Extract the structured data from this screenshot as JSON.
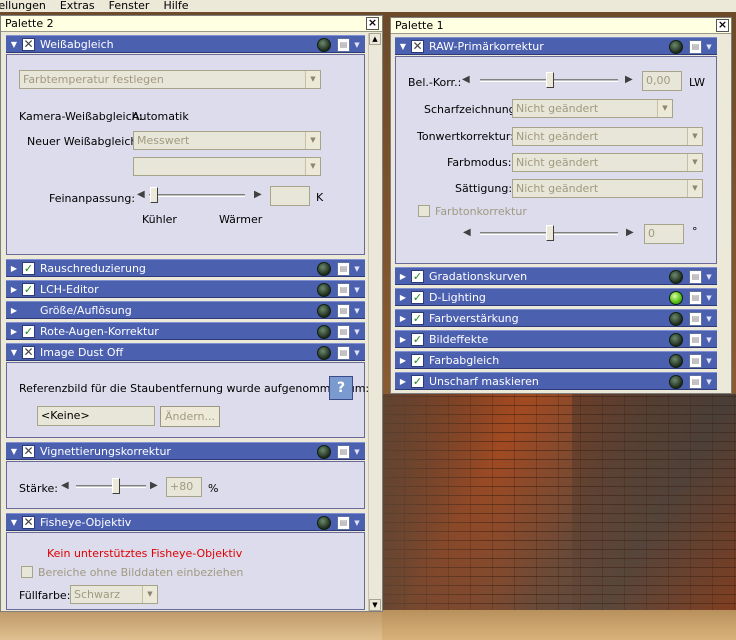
{
  "menu": [
    "tellungen",
    "Extras",
    "Fenster",
    "Hilfe"
  ],
  "palette2": {
    "title": "Palette 2",
    "close": "×",
    "wb": {
      "title": "Weißabgleich",
      "dropdown": "Farbtemperatur festlegen",
      "camera_label": "Kamera-Weißabgleich:",
      "camera_value": "Automatik",
      "new_label": "Neuer Weißabgleich:",
      "new_value": "Messwert",
      "second_value": "",
      "fine_label": "Feinanpassung:",
      "fine_value": "",
      "fine_unit": "K",
      "cooler": "Kühler",
      "warmer": "Wärmer"
    },
    "sections": [
      {
        "label": "Rauschreduzierung"
      },
      {
        "label": "LCH-Editor"
      },
      {
        "label": "Größe/Auflösung"
      },
      {
        "label": "Rote-Augen-Korrektur"
      }
    ],
    "dust": {
      "title": "Image Dust Off",
      "message": "Referenzbild für die Staubentfernung wurde aufgenommen um:",
      "field": "<Keine>",
      "button": "Ändern..."
    },
    "vignette": {
      "title": "Vignettierungskorrektur",
      "label": "Stärke:",
      "value": "+80",
      "unit": "%"
    },
    "fisheye": {
      "title": "Fisheye-Objektiv",
      "warning": "Kein unterstütztes Fisheye-Objektiv",
      "checkbox": "Bereiche ohne Bilddaten einbeziehen",
      "fill_label": "Füllfarbe:",
      "fill_value": "Schwarz"
    }
  },
  "palette1": {
    "title": "Palette 1",
    "close": "×",
    "raw": {
      "title": "RAW-Primärkorrektur",
      "exposure_label": "Bel.-Korr.:",
      "exposure_value": "0,00",
      "exposure_unit": "LW",
      "rows": [
        {
          "label": "Scharfzeichnung:",
          "value": "Nicht geändert"
        },
        {
          "label": "Tonwertkorrektur:",
          "value": "Nicht geändert"
        },
        {
          "label": "Farbmodus:",
          "value": "Nicht geändert"
        },
        {
          "label": "Sättigung:",
          "value": "Nicht geändert"
        }
      ],
      "hue_checkbox": "Farbtonkorrektur",
      "hue_value": "0",
      "hue_unit": "°"
    },
    "sections": [
      {
        "label": "Gradationskurven",
        "active": false
      },
      {
        "label": "D-Lighting",
        "active": true
      },
      {
        "label": "Farbverstärkung",
        "active": false
      },
      {
        "label": "Bildeffekte",
        "active": false
      },
      {
        "label": "Farbabgleich",
        "active": false
      },
      {
        "label": "Unscharf maskieren",
        "active": false
      }
    ]
  },
  "icons": {
    "expanded": "triangle-down-icon",
    "collapsed": "triangle-right-icon",
    "enabled": "checkmark-icon",
    "disabled": "x-checkbox-icon",
    "status": "status-lamp-icon",
    "page": "page-icon",
    "help": "help-icon"
  },
  "colors": {
    "section_header": "#4c60b0",
    "panel_body": "#dcdced",
    "lamp_on": "#5cc21a",
    "warning_text": "#e00000"
  }
}
